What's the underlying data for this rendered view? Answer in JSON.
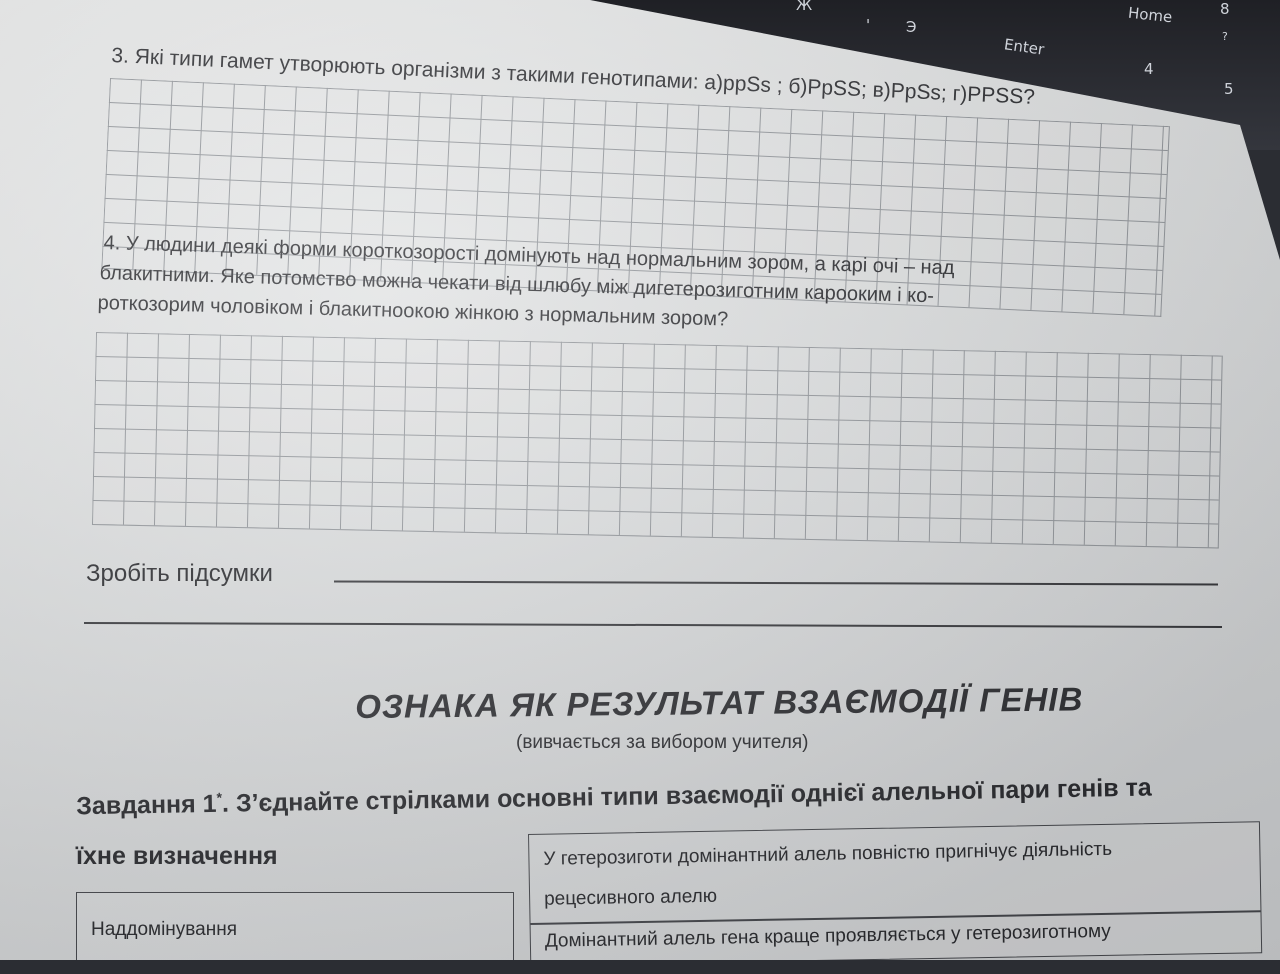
{
  "keyboard": {
    "keys": [
      "<",
      "Ж",
      "'",
      "Э",
      "Enter",
      "Home",
      "8",
      "?",
      "4",
      "5"
    ]
  },
  "question3": {
    "text": "3. Які типи гамет утворюють організми з такими генотипами: а)ppSs ; б)PpSS; в)PpSs; г)PPSS?"
  },
  "question4": {
    "line1": "4. У людини деякі форми короткозорості домінують над нормальним зором, а карі очі – над",
    "line2": "блакитними. Яке потомство можна чекати від шлюбу між дигетерозиготним карооким і ко-",
    "line3": "роткозорим чоловіком і блакитноокою жінкою з нормальним зором?"
  },
  "summary": {
    "label": "Зробіть підсумки"
  },
  "section": {
    "title": "ОЗНАКА ЯК РЕЗУЛЬТАТ ВЗАЄМОДІЇ ГЕНІВ",
    "subtitle": "(вивчається за вибором учителя)"
  },
  "task1": {
    "prefix": "Завдання 1",
    "mark": "*",
    "line1": ". З’єднайте стрілками основні типи взаємодії однієї алельної пари генів та",
    "line2": "їхне визначення"
  },
  "match": {
    "left_term": "Наддомінування",
    "right_def1_line1": "У гетерозиготи домінантний алель повністю пригнічує діяльність",
    "right_def1_line2": "рецесивного алелю",
    "right_def2_line1": "Домінантний алель гена краще проявляється у гетерозиготному"
  }
}
